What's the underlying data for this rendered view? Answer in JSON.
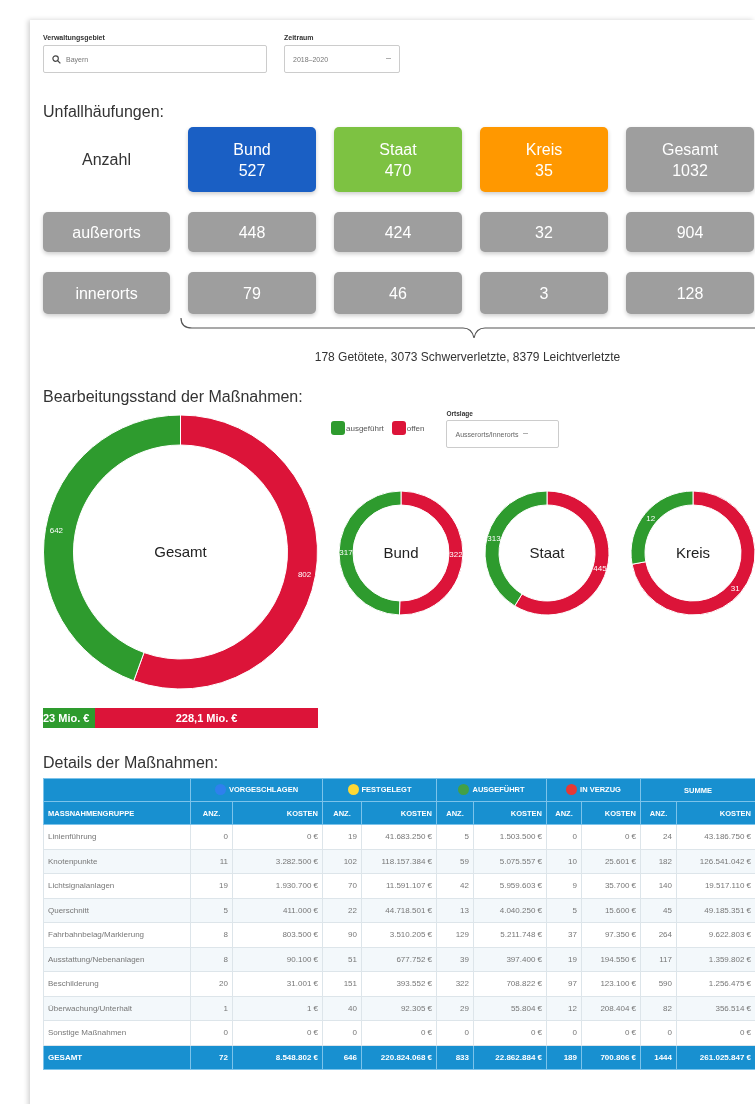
{
  "filters": [
    {
      "kind": "search",
      "label": "Verwaltungsgebiet",
      "value": "Bayern"
    },
    {
      "kind": "select",
      "label": "Zeitraum",
      "value": "2018–2020"
    }
  ],
  "accidents": {
    "title": "Unfallhäufungen:",
    "header_label": "Anzahl",
    "columns": [
      {
        "name": "Bund",
        "total": "527",
        "color": "#1a5fc4"
      },
      {
        "name": "Staat",
        "total": "470",
        "color": "#7dc242"
      },
      {
        "name": "Kreis",
        "total": "35",
        "color": "#ff9800"
      },
      {
        "name": "Gesamt",
        "total": "1032",
        "color": "#9e9e9e"
      }
    ],
    "rows": [
      {
        "label": "außerorts",
        "values": [
          "448",
          "424",
          "32",
          "904"
        ]
      },
      {
        "label": "innerorts",
        "values": [
          "79",
          "46",
          "3",
          "128"
        ]
      }
    ],
    "summary": "178 Getötete, 3073 Schwerverletzte, 8379 Leichtverletzte"
  },
  "measures": {
    "title": "Bearbeitungsstand der Maßnahmen:",
    "legend": [
      {
        "label": "ausgeführt",
        "color": "#2e9b2e"
      },
      {
        "label": "offen",
        "color": "#dc1439"
      }
    ],
    "location_filter": {
      "label": "Ortslage",
      "value": "Ausserorts/Innerorts"
    },
    "donuts": [
      {
        "chart_data": {
          "type": "donut",
          "title": "Gesamt",
          "values": [
            642,
            802
          ],
          "data_labels": true
        }
      },
      {
        "chart_data": {
          "type": "donut",
          "title": "Bund",
          "values": [
            317,
            322
          ],
          "data_labels": true
        }
      },
      {
        "chart_data": {
          "type": "donut",
          "title": "Staat",
          "values": [
            313,
            445
          ],
          "data_labels": true
        }
      },
      {
        "chart_data": {
          "type": "donut",
          "title": "Kreis",
          "values": [
            12,
            31
          ],
          "data_labels": true
        }
      }
    ],
    "cost_bar": {
      "level": 0.19,
      "done_label": "23 Mio. €",
      "open_label": "228,1 Mio. €"
    }
  },
  "details": {
    "title": "Details der Maßnahmen:",
    "groups": [
      {
        "label": "VORGESCHLAGEN",
        "color": "#2f80ed"
      },
      {
        "label": "FESTGELEGT",
        "color": "#fdd835"
      },
      {
        "label": "AUSGEFÜHRT",
        "color": "#43a047"
      },
      {
        "label": "IN VERZUG",
        "color": "#e53935"
      },
      {
        "label": "SUMME"
      }
    ],
    "columns": [
      "MASSNAHMENGRUPPE",
      "ANZ.",
      "KOSTEN",
      "ANZ.",
      "KOSTEN",
      "ANZ.",
      "KOSTEN",
      "ANZ.",
      "KOSTEN",
      "ANZ.",
      "KOSTEN"
    ],
    "rows": [
      [
        "Linienführung",
        "0",
        "0 €",
        "19",
        "41.683.250 €",
        "5",
        "1.503.500 €",
        "0",
        "0 €",
        "24",
        "43.186.750 €"
      ],
      [
        "Knotenpunkte",
        "11",
        "3.282.500 €",
        "102",
        "118.157.384 €",
        "59",
        "5.075.557 €",
        "10",
        "25.601 €",
        "182",
        "126.541.042 €"
      ],
      [
        "Lichtsignalanlagen",
        "19",
        "1.930.700 €",
        "70",
        "11.591.107 €",
        "42",
        "5.959.603 €",
        "9",
        "35.700 €",
        "140",
        "19.517.110 €"
      ],
      [
        "Querschnitt",
        "5",
        "411.000 €",
        "22",
        "44.718.501 €",
        "13",
        "4.040.250 €",
        "5",
        "15.600 €",
        "45",
        "49.185.351 €"
      ],
      [
        "Fahrbahnbelag/Markierung",
        "8",
        "803.500 €",
        "90",
        "3.510.205 €",
        "129",
        "5.211.748 €",
        "37",
        "97.350 €",
        "264",
        "9.622.803 €"
      ],
      [
        "Ausstattung/Nebenanlagen",
        "8",
        "90.100 €",
        "51",
        "677.752 €",
        "39",
        "397.400 €",
        "19",
        "194.550 €",
        "117",
        "1.359.802 €"
      ],
      [
        "Beschilderung",
        "20",
        "31.001 €",
        "151",
        "393.552 €",
        "322",
        "708.822 €",
        "97",
        "123.100 €",
        "590",
        "1.256.475 €"
      ],
      [
        "Überwachung/Unterhalt",
        "1",
        "1 €",
        "40",
        "92.305 €",
        "29",
        "55.804 €",
        "12",
        "208.404 €",
        "82",
        "356.514 €"
      ],
      [
        "Sonstige Maßnahmen",
        "0",
        "0 €",
        "0",
        "0 €",
        "0",
        "0 €",
        "0",
        "0 €",
        "0",
        "0 €"
      ]
    ],
    "total": [
      "GESAMT",
      "72",
      "8.548.802 €",
      "646",
      "220.824.068 €",
      "833",
      "22.862.884 €",
      "189",
      "700.806 €",
      "1444",
      "261.025.847 €"
    ]
  }
}
